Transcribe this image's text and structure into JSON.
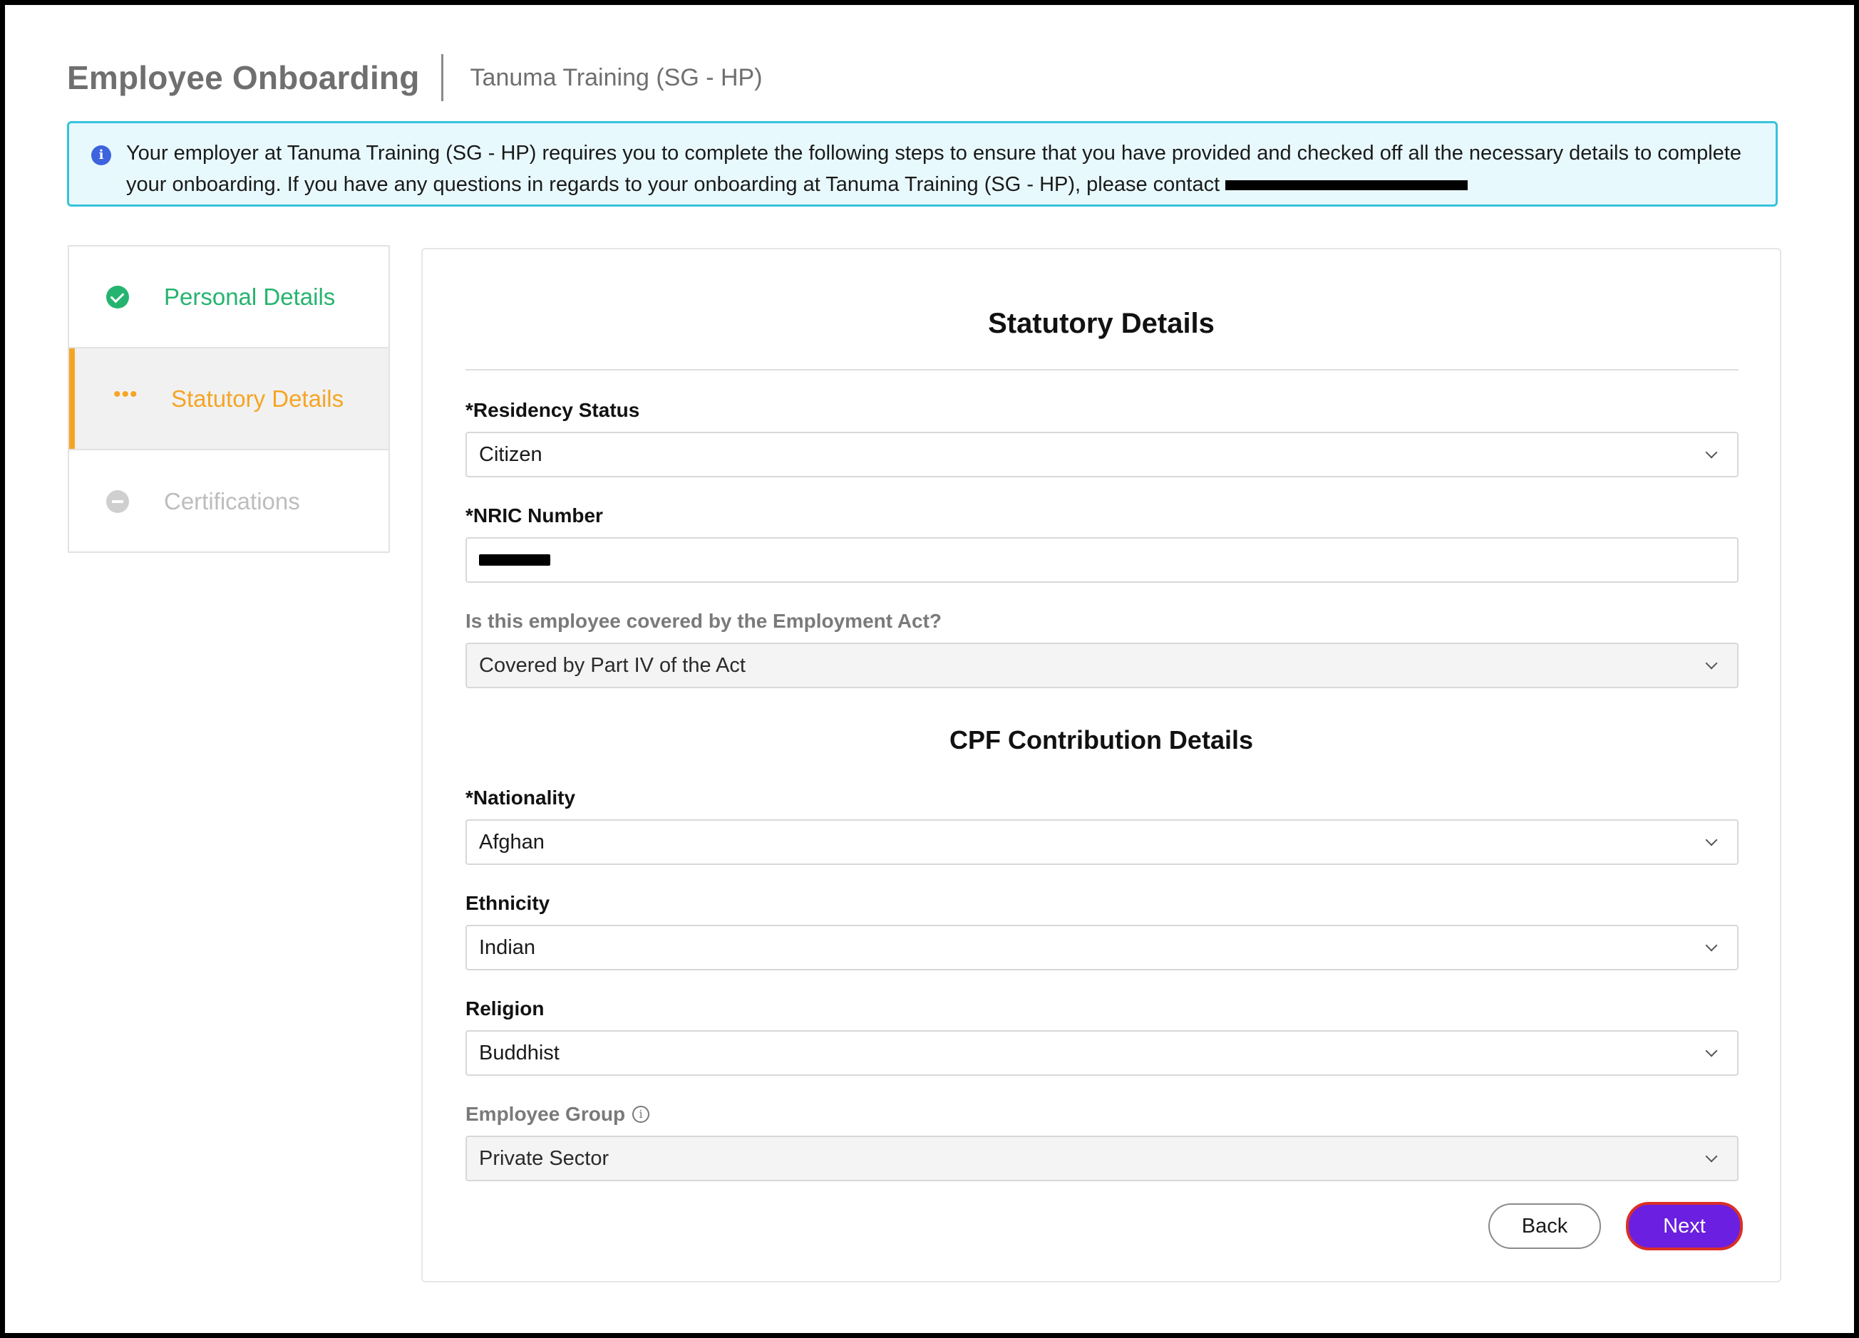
{
  "header": {
    "title": "Employee Onboarding",
    "company": "Tanuma Training (SG - HP)"
  },
  "banner": {
    "text": "Your employer at Tanuma Training (SG - HP) requires you to complete the following steps to ensure that you have provided and checked off all the necessary details to complete your onboarding. If you have any questions in regards to your onboarding at Tanuma Training (SG - HP), please contact ",
    "icon": "info-icon"
  },
  "steps": [
    {
      "label": "Personal Details",
      "state": "completed"
    },
    {
      "label": "Statutory Details",
      "state": "in-progress"
    },
    {
      "label": "Certifications",
      "state": "pending"
    }
  ],
  "form": {
    "title": "Statutory Details",
    "residency": {
      "label": "*Residency Status",
      "value": "Citizen"
    },
    "nric": {
      "label": "*NRIC Number"
    },
    "employment_act": {
      "label": "Is this employee covered by the Employment Act?",
      "value": "Covered by Part IV of the Act"
    },
    "cpf_title": "CPF Contribution Details",
    "nationality": {
      "label": "*Nationality",
      "value": "Afghan"
    },
    "ethnicity": {
      "label": "Ethnicity",
      "value": "Indian"
    },
    "religion": {
      "label": "Religion",
      "value": "Buddhist"
    },
    "employee_group": {
      "label": "Employee Group",
      "value": "Private Sector"
    }
  },
  "buttons": {
    "back": "Back",
    "next": "Next"
  },
  "colors": {
    "completed": "#25b46f",
    "active": "#f5a524",
    "primary": "#6b1fe0",
    "banner_border": "#37c3dc",
    "banner_bg": "#e8f9fd"
  }
}
